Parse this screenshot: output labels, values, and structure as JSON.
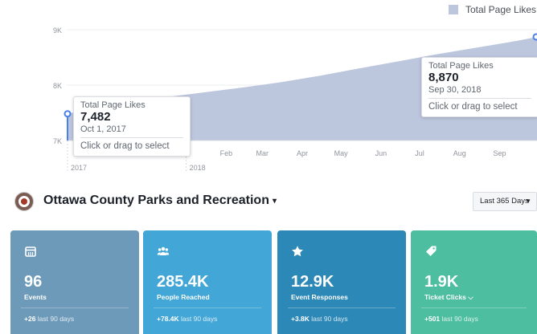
{
  "colors": {
    "area": "#bcc6dd",
    "marker": "#4a80e8",
    "card1": "#6d9ab9",
    "card2": "#42a6d6",
    "card3": "#2c88b7",
    "card4": "#4dbea0"
  },
  "legend": {
    "label": "Total Page Likes"
  },
  "chart_data": {
    "type": "area",
    "series": [
      {
        "name": "Total Page Likes",
        "values": [
          {
            "x": "2017-10-01",
            "y": 7482
          },
          {
            "x": "2017-10-20",
            "y": 7580
          },
          {
            "x": "2017-11-15",
            "y": 7690
          },
          {
            "x": "2017-12-15",
            "y": 7780
          },
          {
            "x": "2018-01-15",
            "y": 7870
          },
          {
            "x": "2018-02-15",
            "y": 7960
          },
          {
            "x": "2018-03-15",
            "y": 8050
          },
          {
            "x": "2018-04-15",
            "y": 8170
          },
          {
            "x": "2018-05-15",
            "y": 8300
          },
          {
            "x": "2018-06-15",
            "y": 8430
          },
          {
            "x": "2018-07-15",
            "y": 8560
          },
          {
            "x": "2018-08-15",
            "y": 8680
          },
          {
            "x": "2018-09-15",
            "y": 8800
          },
          {
            "x": "2018-09-30",
            "y": 8870
          }
        ]
      }
    ],
    "y_ticks": [
      {
        "label": "9K",
        "value": 9000
      },
      {
        "label": "8K",
        "value": 8000
      },
      {
        "label": "7K",
        "value": 7000
      }
    ],
    "ylim": [
      7000,
      9000
    ],
    "x_ticks": [
      {
        "label": "2017",
        "sub": "",
        "date": "2017-10-01"
      },
      {
        "label": "2018",
        "sub": "",
        "date": "2018-01-01"
      },
      {
        "label": "Feb",
        "sub": "",
        "date": "2018-02-01"
      },
      {
        "label": "Mar",
        "sub": "",
        "date": "2018-03-01"
      },
      {
        "label": "Apr",
        "sub": "",
        "date": "2018-04-01"
      },
      {
        "label": "May",
        "sub": "",
        "date": "2018-05-01"
      },
      {
        "label": "Jun",
        "sub": "",
        "date": "2018-06-01"
      },
      {
        "label": "Jul",
        "sub": "",
        "date": "2018-07-01"
      },
      {
        "label": "Aug",
        "sub": "",
        "date": "2018-08-01"
      },
      {
        "label": "Sep",
        "sub": "",
        "date": "2018-09-01"
      }
    ],
    "grid": true,
    "legend_position": "top-right"
  },
  "tooltips": {
    "start": {
      "title": "Total Page Likes",
      "value": "7,482",
      "date": "Oct 1, 2017",
      "action": "Click or drag to select"
    },
    "end": {
      "title": "Total Page Likes",
      "value": "8,870",
      "date": "Sep 30, 2018",
      "action": "Click or drag to select"
    }
  },
  "page": {
    "name": "Ottawa County Parks and Recreation",
    "caret": "▾",
    "range": "Last 365 Days",
    "range_caret": "▼"
  },
  "cards": [
    {
      "icon": "calendar-icon",
      "value": "96",
      "label": "Events",
      "delta": "+26",
      "period": "last 90 days",
      "color": "#6d9ab9"
    },
    {
      "icon": "people-icon",
      "value": "285.4K",
      "label": "People Reached",
      "delta": "+78.4K",
      "period": "last 90 days",
      "color": "#42a6d6"
    },
    {
      "icon": "star-icon",
      "value": "12.9K",
      "label": "Event Responses",
      "delta": "+3.8K",
      "period": "last 90 days",
      "color": "#2c88b7"
    },
    {
      "icon": "ticket-icon",
      "value": "1.9K",
      "label": "Ticket Clicks",
      "label_caret": "⌵",
      "delta": "+501",
      "period": "last 90 days",
      "color": "#4dbea0"
    }
  ]
}
